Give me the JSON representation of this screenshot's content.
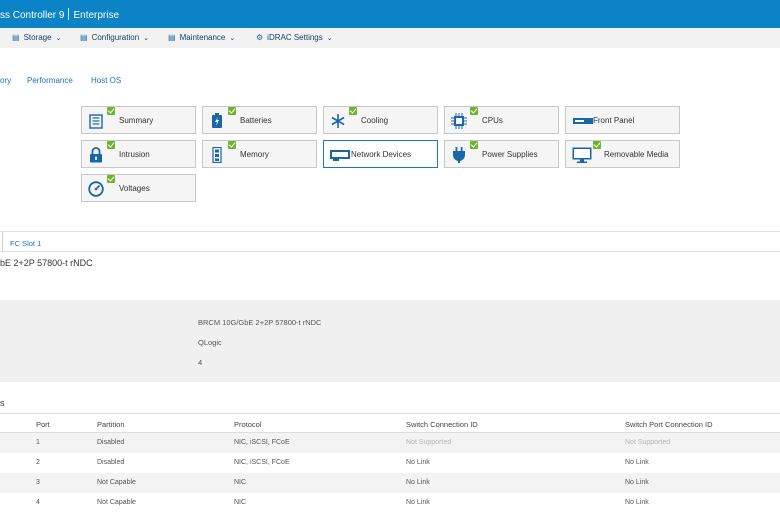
{
  "header": {
    "title_left": "ss Controller 9",
    "title_right": "Enterprise"
  },
  "menu": [
    {
      "label": "Storage",
      "icon": "storage-icon"
    },
    {
      "label": "Configuration",
      "icon": "configuration-icon"
    },
    {
      "label": "Maintenance",
      "icon": "maintenance-icon"
    },
    {
      "label": "iDRAC Settings",
      "icon": "idrac-settings-icon"
    }
  ],
  "subtabs": [
    "ory",
    "Performance",
    "Host OS"
  ],
  "tiles": [
    {
      "label": "Summary",
      "icon": "summary-icon"
    },
    {
      "label": "Batteries",
      "icon": "battery-icon"
    },
    {
      "label": "Cooling",
      "icon": "snowflake-icon"
    },
    {
      "label": "CPUs",
      "icon": "cpu-icon"
    },
    {
      "label": "Front Panel",
      "icon": "front-panel-icon"
    },
    {
      "label": "Intrusion",
      "icon": "lock-icon"
    },
    {
      "label": "Memory",
      "icon": "memory-icon"
    },
    {
      "label": "Network Devices",
      "icon": "network-card-icon"
    },
    {
      "label": "Power Supplies",
      "icon": "power-plug-icon"
    },
    {
      "label": "Removable Media",
      "icon": "monitor-icon"
    },
    {
      "label": "Voltages",
      "icon": "gauge-icon"
    }
  ],
  "slot_tab": "FC Slot 1",
  "device_title": "bE 2+2P 57800-t rNDC",
  "info": {
    "product": "BRCM 10G/GbE 2+2P 57800-t rNDC",
    "vendor": "QLogic",
    "ports": "4"
  },
  "section_title": "s",
  "table": {
    "columns": [
      "Port",
      "Partition",
      "Protocol",
      "Switch Connection ID",
      "Switch Port Connection ID"
    ],
    "rows": [
      [
        "1",
        "Disabled",
        "NIC, iSCSI, FCoE",
        "Not Supported",
        "Not Supported"
      ],
      [
        "2",
        "Disabled",
        "NIC, iSCSI, FCoE",
        "No Link",
        "No Link"
      ],
      [
        "3",
        "Not Capable",
        "NIC",
        "No Link",
        "No Link"
      ],
      [
        "4",
        "Not Capable",
        "NIC",
        "No Link",
        "No Link"
      ]
    ]
  },
  "colors": {
    "brand": "#0b83c6",
    "ok": "#6fb32e",
    "link": "#1a73c0"
  }
}
